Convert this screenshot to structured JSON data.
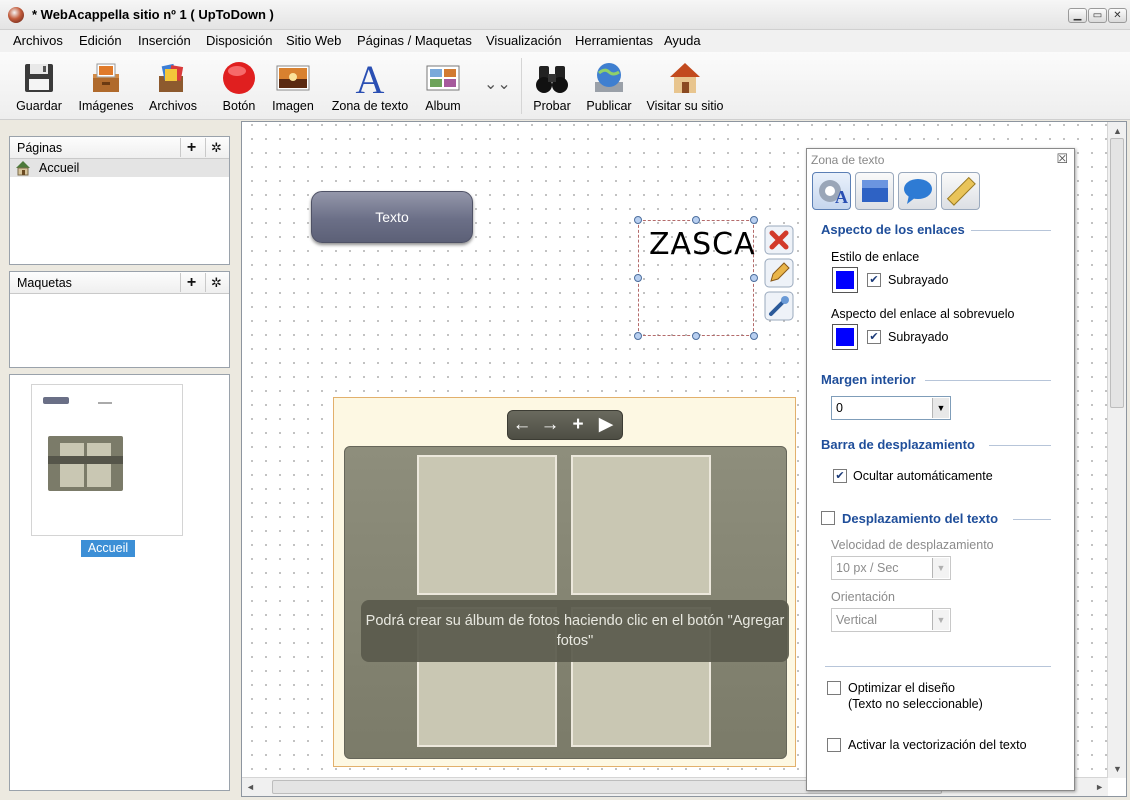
{
  "window": {
    "title": "* WebAcappella sitio nº 1 ( UpToDown )"
  },
  "menu": [
    "Archivos",
    "Edición",
    "Inserción",
    "Disposición",
    "Sitio Web",
    "Páginas / Maquetas",
    "Visualización",
    "Herramientas",
    "Ayuda"
  ],
  "toolbar": [
    {
      "label": "Guardar",
      "icon": "floppy-disk-icon"
    },
    {
      "label": "Imágenes",
      "icon": "image-drawer-icon"
    },
    {
      "label": "Archivos",
      "icon": "files-box-icon"
    },
    {
      "label": "Botón",
      "icon": "red-button-icon"
    },
    {
      "label": "Imagen",
      "icon": "picture-icon"
    },
    {
      "label": "Zona de texto",
      "icon": "text-zone-icon"
    },
    {
      "label": "Album",
      "icon": "photo-album-icon"
    },
    {
      "label": "Probar",
      "icon": "binoculars-icon"
    },
    {
      "label": "Publicar",
      "icon": "globe-monitor-icon"
    },
    {
      "label": "Visitar su sitio",
      "icon": "house-icon"
    }
  ],
  "pages_panel": {
    "title": "Páginas",
    "items": [
      "Accueil"
    ]
  },
  "templates_panel": {
    "title": "Maquetas"
  },
  "thumbnail": {
    "label": "Accueil"
  },
  "canvas": {
    "button_text": "Texto",
    "text_zone": "ZASCA",
    "album_hint": "Podrá crear su álbum de fotos haciendo clic en el botón \"Agregar fotos\""
  },
  "props": {
    "title": "Zona de texto",
    "link_section": "Aspecto de los enlaces",
    "link_style_label": "Estilo de enlace",
    "underline_label": "Subrayado",
    "hover_label": "Aspecto del enlace al sobrevuelo",
    "underline_label_2": "Subrayado",
    "padding_section": "Margen interior",
    "padding_value": "0",
    "scrollbar_section": "Barra de desplazamiento",
    "autohide_label": "Ocultar automáticamente",
    "textscroll_section": "Desplazamiento del texto",
    "speed_label": "Velocidad de desplazamiento",
    "speed_value": "10 px / Sec",
    "orientation_label": "Orientación",
    "orientation_value": "Vertical",
    "optimize_label": "Optimizar el diseño",
    "optimize_sub": "(Texto no seleccionable)",
    "vectorize_label": "Activar la vectorización del texto"
  },
  "colors": {
    "link": "#0000ff",
    "section_title": "#1f4e9a"
  }
}
